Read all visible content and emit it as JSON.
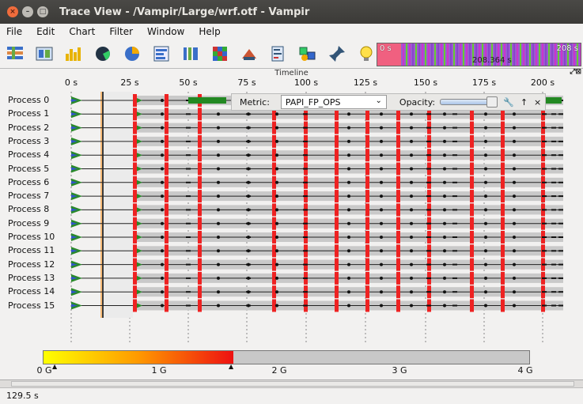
{
  "window": {
    "title": "Trace View - /Vampir/Large/wrf.otf - Vampir",
    "buttons": [
      "close",
      "minimize",
      "maximize"
    ]
  },
  "menu": [
    "File",
    "Edit",
    "Chart",
    "Filter",
    "Window",
    "Help"
  ],
  "toolbar": {
    "icons": [
      "master-timeline-icon",
      "process-timeline-icon",
      "counter-timeline-icon",
      "performance-radar-icon",
      "function-summary-icon",
      "process-summary-icon",
      "message-summary-icon",
      "communication-matrix-icon",
      "io-events-icon",
      "call-tree-icon",
      "function-legend-icon",
      "marker-view-icon",
      "context-view-icon"
    ]
  },
  "overview": {
    "start_label": "0 s",
    "mid_label": "208.364 s",
    "end_label": "208 s"
  },
  "timeline": {
    "header": "Timeline",
    "ticks": [
      "0 s",
      "25 s",
      "50 s",
      "75 s",
      "100 s",
      "125 s",
      "150 s",
      "175 s",
      "200 s"
    ],
    "processes": [
      "Process 0",
      "Process 1",
      "Process 2",
      "Process 3",
      "Process 4",
      "Process 5",
      "Process 6",
      "Process 7",
      "Process 8",
      "Process 9",
      "Process 10",
      "Process 11",
      "Process 12",
      "Process 13",
      "Process 14",
      "Process 15"
    ]
  },
  "metric": {
    "label": "Metric:",
    "value": "PAPI_FP_OPS",
    "opacity_label": "Opacity:",
    "opacity": 0.85
  },
  "legend": {
    "ticks": [
      "0 G",
      "1 G",
      "2 G",
      "3 G",
      "4 G"
    ]
  },
  "status": {
    "text": "129.5 s"
  },
  "colors": {
    "accent_red": "#ee2222",
    "band_green": "#228822",
    "overview_purple": "#9b5bd0"
  }
}
